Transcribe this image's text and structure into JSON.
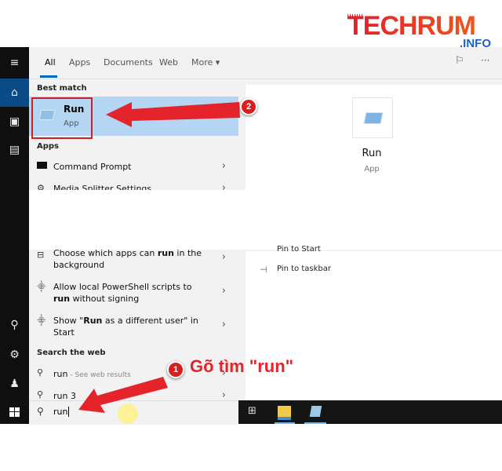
{
  "logo": {
    "main": "TECHRUM",
    "suffix": ".INFO"
  },
  "tabs": [
    {
      "label": "All",
      "active": true
    },
    {
      "label": "Apps",
      "active": false
    },
    {
      "label": "Documents",
      "active": false
    },
    {
      "label": "Web",
      "active": false
    },
    {
      "label": "More ▾",
      "active": false
    }
  ],
  "header_icons": [
    "feedback-icon",
    "more-options-icon"
  ],
  "rail": {
    "icons": [
      "hamburger-menu-icon",
      "home-icon",
      "documents-icon",
      "apps-icon",
      "user-icon",
      "settings-icon",
      "user-switch-icon"
    ]
  },
  "best_match": {
    "section": "Best match",
    "title": "Run",
    "subtitle": "App"
  },
  "apps": {
    "section": "Apps",
    "items": [
      {
        "label": "Command Prompt"
      },
      {
        "label": "Media Splitter Settings"
      }
    ]
  },
  "settings_items": [
    {
      "pre": "Choose which apps can ",
      "bold": "run",
      "post": " in the background"
    },
    {
      "pre": "Allow local PowerShell scripts to ",
      "bold": "run",
      "post": " without signing"
    },
    {
      "pre": "Show \"",
      "bold": "Run",
      "post": " as a different user\" in Start"
    }
  ],
  "web": {
    "section": "Search the web",
    "items": [
      {
        "main": "run",
        "hint": " - See web results"
      },
      {
        "main": "run 3",
        "hint": ""
      }
    ]
  },
  "search": {
    "value": "run"
  },
  "preview": {
    "title": "Run",
    "subtitle": "App",
    "actions": [
      {
        "label": "Pin to Start"
      },
      {
        "label": "Pin to taskbar"
      }
    ]
  },
  "annotations": {
    "step1_number": "1",
    "step1_text": "Gõ tìm \"run\"",
    "step2_number": "2"
  },
  "colors": {
    "accent": "#0067c0",
    "highlight": "#b5d6f3",
    "annotation_red": "#e4232b"
  }
}
